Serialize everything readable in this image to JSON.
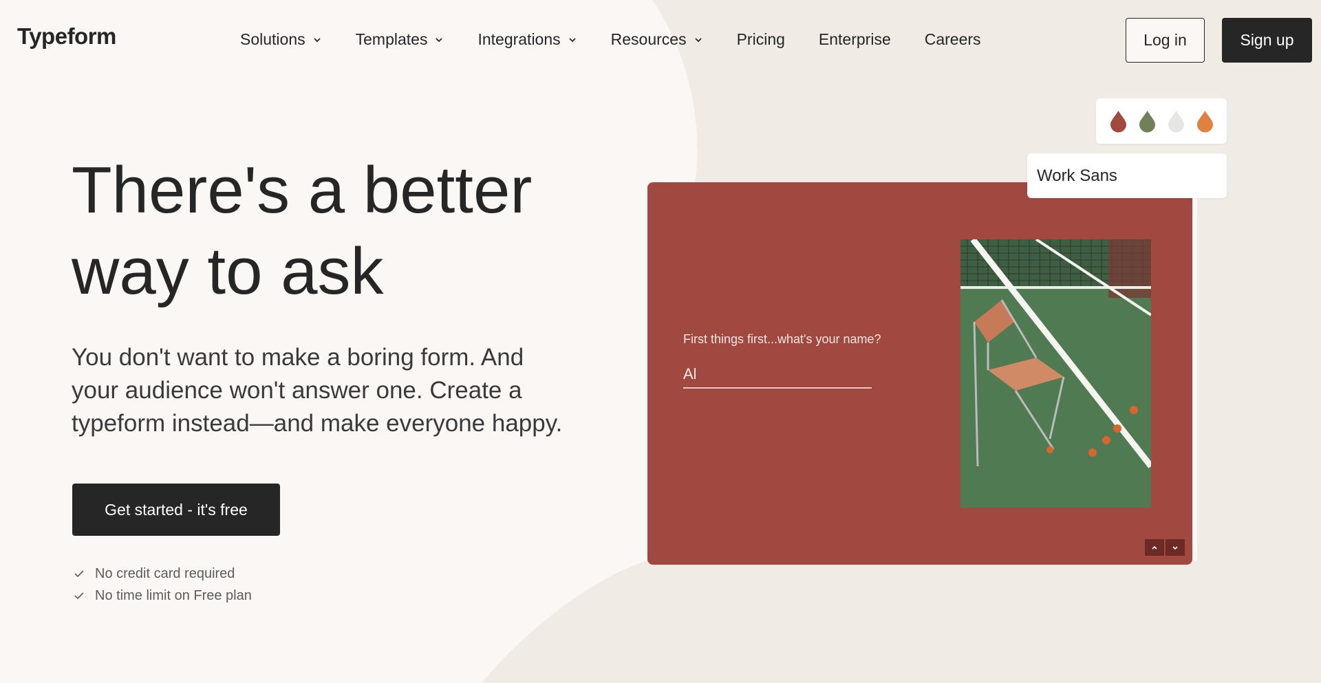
{
  "header": {
    "logo": "Typeform",
    "nav": [
      {
        "label": "Solutions",
        "has_dropdown": true
      },
      {
        "label": "Templates",
        "has_dropdown": true
      },
      {
        "label": "Integrations",
        "has_dropdown": true
      },
      {
        "label": "Resources",
        "has_dropdown": true
      },
      {
        "label": "Pricing",
        "has_dropdown": false
      },
      {
        "label": "Enterprise",
        "has_dropdown": false
      },
      {
        "label": "Careers",
        "has_dropdown": false
      }
    ],
    "login_label": "Log in",
    "signup_label": "Sign up"
  },
  "hero": {
    "title_line1": "There's a better",
    "title_line2": "way to ask",
    "subtitle_line1": "You don't want to make a boring form. And",
    "subtitle_line2": "your audience won't answer one. Create a",
    "subtitle_line3": "typeform instead—and make everyone happy.",
    "cta_label": "Get started - it's free",
    "checks": [
      "No credit card required",
      "No time limit on Free plan"
    ]
  },
  "demo": {
    "question": "First things first...what's your name?",
    "answer": "Al",
    "font_name": "Work Sans",
    "palette": [
      "#a14841",
      "#6f805a",
      "#e6e6e4",
      "#e0823f"
    ],
    "card_color": "#a14841",
    "icons": {
      "up": "chevron-up-icon",
      "down": "chevron-down-icon"
    }
  },
  "colors": {
    "background": "#faf7f5",
    "dark": "#262627",
    "shape": "#f1ebe6"
  }
}
